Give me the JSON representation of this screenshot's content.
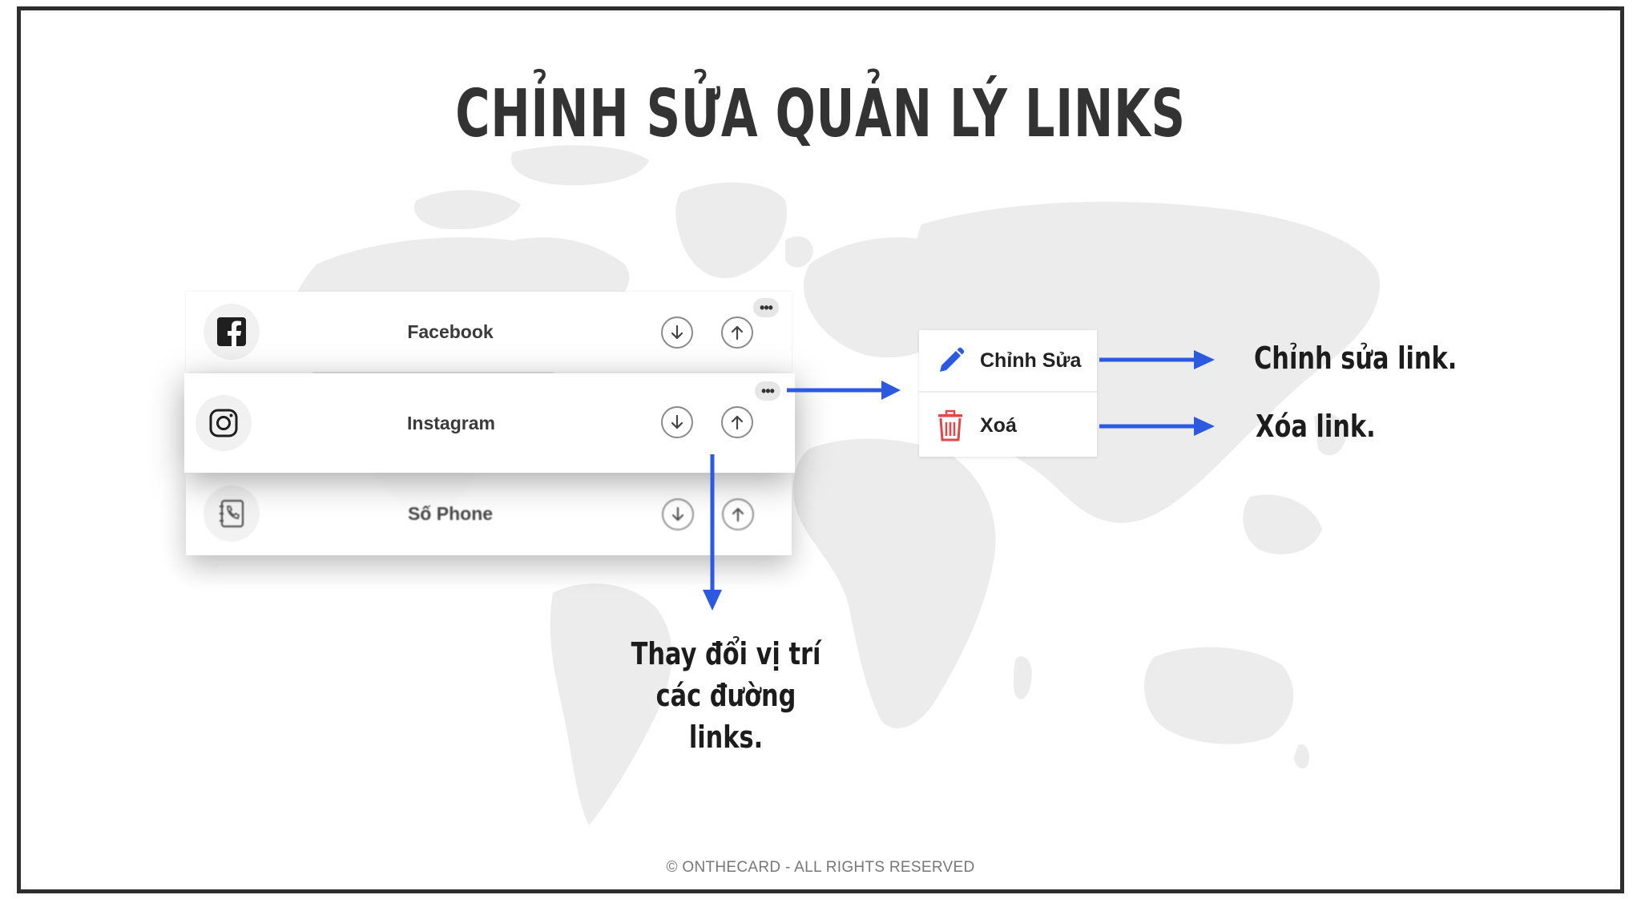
{
  "slide": {
    "title": "CHỈNH SỬA QUẢN LÝ LINKS",
    "footer": "©  ONTHECARD - ALL RIGHTS RESERVED"
  },
  "links": [
    {
      "label": "Facebook",
      "icon": "facebook-icon"
    },
    {
      "label": "Instagram",
      "icon": "instagram-icon"
    },
    {
      "label": "Số Phone",
      "icon": "phone-book-icon"
    }
  ],
  "row_actions": {
    "more": "•••",
    "move_down_icon": "arrow-down-circle-icon",
    "move_up_icon": "arrow-up-circle-icon"
  },
  "menu": {
    "edit_label": "Chỉnh Sửa",
    "delete_label": "Xoá"
  },
  "notes": {
    "edit": "Chỉnh sửa link.",
    "delete": "Xóa link.",
    "reorder": "Thay đổi vị trí các đường links."
  },
  "colors": {
    "arrow": "#2b59e0",
    "edit_icon": "#2b59e0",
    "delete_icon": "#e04848",
    "title": "#333333",
    "map": "#ececec"
  }
}
